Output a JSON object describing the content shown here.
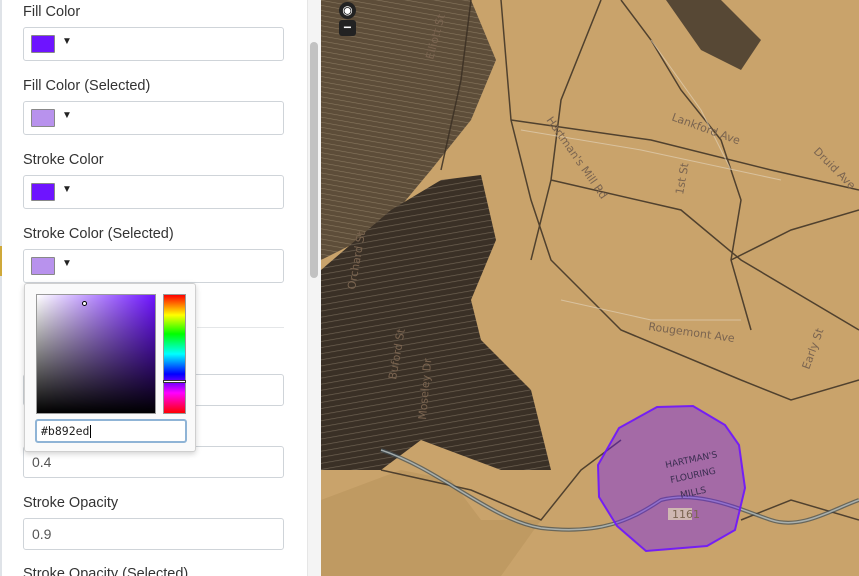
{
  "panel": {
    "fill_color": {
      "label": "Fill Color",
      "swatch": "#6e14ff",
      "caret": "▼"
    },
    "fill_color_selected": {
      "label": "Fill Color (Selected)",
      "swatch": "#b892ed",
      "caret": "▼"
    },
    "stroke_color": {
      "label": "Stroke Color",
      "swatch": "#6e14ff",
      "caret": "▼"
    },
    "stroke_color_selected": {
      "label": "Stroke Color (Selected)",
      "swatch": "#b892ed",
      "caret": "▼"
    },
    "fill_opacity_selected": {
      "value": "0.4"
    },
    "stroke_opacity": {
      "label": "Stroke Opacity",
      "value": "0.9"
    },
    "stroke_opacity_selected": {
      "label": "Stroke Opacity (Selected)"
    }
  },
  "picker": {
    "hex_value": "#b892ed"
  },
  "map": {
    "zoom_out_label": "−",
    "globe_icon": "globe-icon",
    "streets": [
      "Lankford Ave",
      "Hartman's Mill Rd",
      "Rougemont Ave",
      "Druid Ave",
      "1st St",
      "Early St",
      "Orchard St",
      "Elliott St",
      "Moseley Dr",
      "Buford St"
    ],
    "historic_label_lines": [
      "HARTMAN'S",
      "FLOURING",
      "MILLS"
    ],
    "route_badge": "1161",
    "polygon_color": "#6e14ff"
  }
}
